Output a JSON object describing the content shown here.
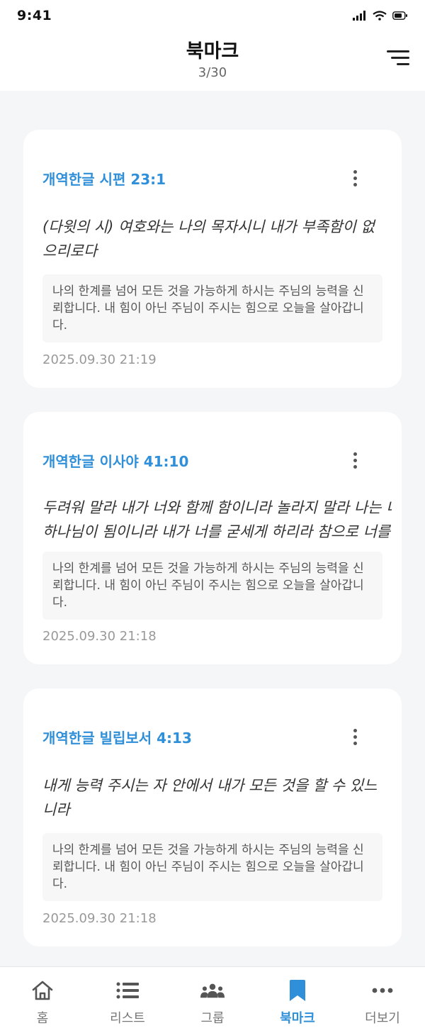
{
  "status_bar": {
    "time": "9:41"
  },
  "header": {
    "title": "북마크",
    "count": "3/30"
  },
  "bookmarks": [
    {
      "reference": "개역한글 시편 23:1",
      "verse": "(다윗의 시) 여호와는 나의 목자시니 내가 부족함이 없으리로다",
      "note": "나의 한계를 넘어 모든 것을 가능하게 하시는 주님의 능력을 신뢰합니다. 내 힘이 아닌 주님이 주시는 힘으로 오늘을 살아갑니다.",
      "date": "2025.09.30 21:19"
    },
    {
      "reference": "개역한글 이사야 41:10",
      "verse_line1": "두려워 말라 내가 너와 함께 함이니라 놀라지 말라 나는 네",
      "verse_line2": "하나님이 됨이니라 내가 너를 굳세게 하리라 참으로 너를 도",
      "note": "나의 한계를 넘어 모든 것을 가능하게 하시는 주님의 능력을 신뢰합니다. 내 힘이 아닌 주님이 주시는 힘으로 오늘을 살아갑니다.",
      "date": "2025.09.30 21:18"
    },
    {
      "reference": "개역한글 빌립보서 4:13",
      "verse": "내게 능력 주시는 자 안에서 내가 모든 것을 할 수 있느니라",
      "note": "나의 한계를 넘어 모든 것을 가능하게 하시는 주님의 능력을 신뢰합니다. 내 힘이 아닌 주님이 주시는 힘으로 오늘을 살아갑니다.",
      "date": "2025.09.30 21:18"
    }
  ],
  "tabbar": {
    "items": [
      {
        "label": "홈",
        "icon": "home-icon"
      },
      {
        "label": "리스트",
        "icon": "list-icon"
      },
      {
        "label": "그룹",
        "icon": "group-icon"
      },
      {
        "label": "북마크",
        "icon": "bookmark-icon"
      },
      {
        "label": "더보기",
        "icon": "more-icon"
      }
    ],
    "active_index": 3
  },
  "colors": {
    "accent": "#2f8fd8",
    "background": "#f5f6f8"
  }
}
